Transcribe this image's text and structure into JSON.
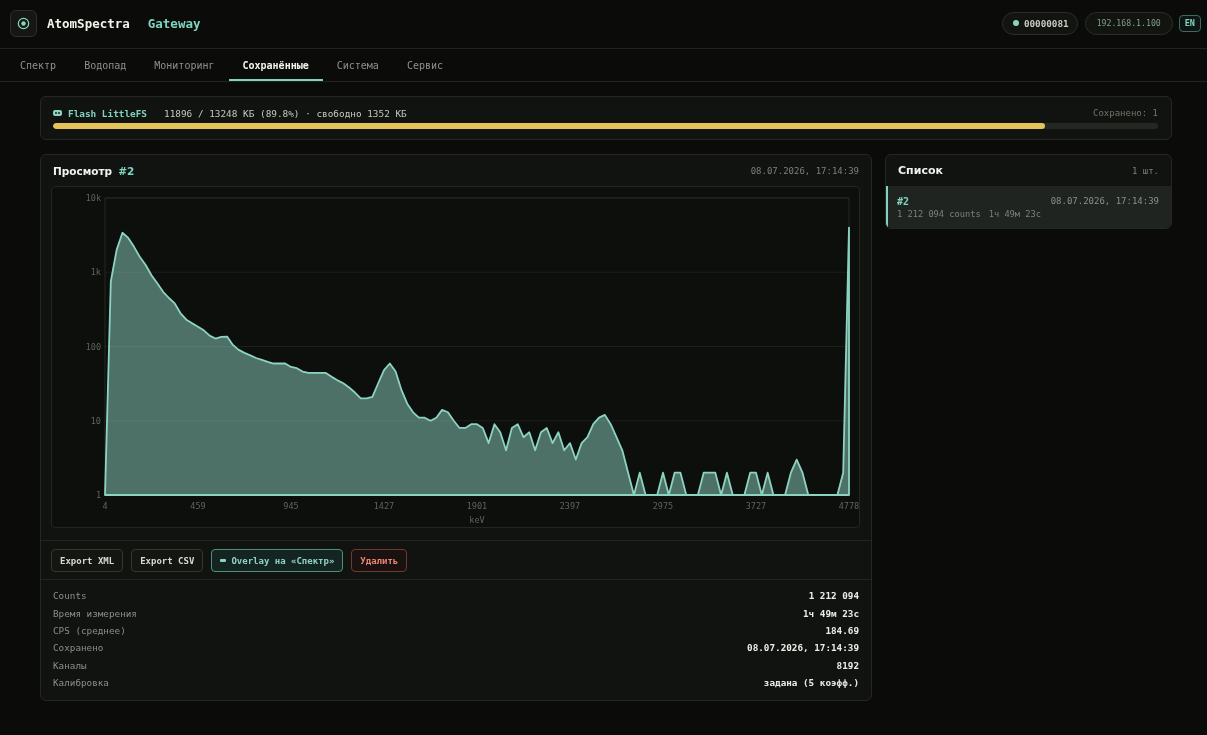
{
  "app": {
    "name": "AtomSpectra",
    "subtitle": "Gateway"
  },
  "status": {
    "device_id": "00000081",
    "ip": "192.168.1.100",
    "language": "EN"
  },
  "tabs": [
    {
      "label": "Спектр",
      "selected": false
    },
    {
      "label": "Водопад",
      "selected": false
    },
    {
      "label": "Мониторинг",
      "selected": false
    },
    {
      "label": "Сохранённые",
      "selected": true
    },
    {
      "label": "Система",
      "selected": false
    },
    {
      "label": "Сервис",
      "selected": false
    }
  ],
  "storage": {
    "name": "Flash LittleFS",
    "usage": "11896 / 13248 КБ (89.8%) · свободно 1352 КБ",
    "saved": "Сохранено: 1",
    "level": 0.898
  },
  "preview": {
    "title": "Просмотр",
    "record_id": "#2",
    "timestamp": "08.07.2026, 17:14:39",
    "chart_data": {
      "type": "area",
      "xlabel": "keV",
      "log": true,
      "grid": true,
      "categories": [
        "4",
        null,
        null,
        null,
        null,
        null,
        null,
        null,
        null,
        null,
        null,
        null,
        null,
        null,
        null,
        null,
        "459",
        null,
        null,
        null,
        null,
        null,
        null,
        null,
        null,
        null,
        null,
        null,
        null,
        null,
        null,
        null,
        "945",
        null,
        null,
        null,
        null,
        null,
        null,
        null,
        null,
        null,
        null,
        null,
        null,
        null,
        null,
        null,
        "1427",
        null,
        null,
        null,
        null,
        null,
        null,
        null,
        null,
        null,
        null,
        null,
        null,
        null,
        null,
        null,
        "1901",
        null,
        null,
        null,
        null,
        null,
        null,
        null,
        null,
        null,
        null,
        null,
        null,
        null,
        null,
        null,
        "2397",
        null,
        null,
        null,
        null,
        null,
        null,
        null,
        null,
        null,
        null,
        null,
        null,
        null,
        null,
        null,
        "2975",
        null,
        null,
        null,
        null,
        null,
        null,
        null,
        null,
        null,
        null,
        null,
        null,
        null,
        null,
        null,
        "3727",
        null,
        null,
        null,
        null,
        null,
        null,
        null,
        null,
        null,
        null,
        null,
        null,
        null,
        null,
        null,
        "4778"
      ],
      "series": [
        {
          "color": "#8dd3c2",
          "values": [
            1,
            750,
            2000,
            3400,
            2900,
            2200,
            1600,
            1250,
            910,
            710,
            545,
            450,
            380,
            280,
            230,
            205,
            185,
            165,
            140,
            128,
            135,
            136,
            105,
            90,
            82,
            76,
            70,
            66,
            62,
            59,
            59,
            59,
            53,
            51,
            46,
            44,
            44,
            44,
            44,
            39,
            35,
            32,
            28,
            24,
            20,
            20,
            21,
            32,
            48,
            59,
            46,
            26,
            17,
            13,
            11,
            11,
            10,
            11,
            14,
            13,
            10,
            8,
            8,
            9,
            9,
            8,
            5,
            9,
            7,
            4,
            8,
            9,
            6,
            7,
            4,
            7,
            8,
            5,
            7,
            4,
            5,
            3,
            5,
            6,
            9,
            11,
            12,
            9,
            6,
            4,
            2,
            1,
            2,
            1,
            1,
            1,
            2,
            1,
            2,
            2,
            1,
            1,
            1,
            2,
            2,
            2,
            1,
            2,
            1,
            1,
            1,
            2,
            2,
            1,
            2,
            1,
            1,
            1,
            2,
            3,
            2,
            1,
            1,
            1,
            1,
            1,
            1,
            2,
            4000
          ]
        }
      ],
      "ylim": [
        1,
        10000
      ],
      "yticks": [
        {
          "value": 1,
          "label": "1"
        },
        {
          "value": 10,
          "label": "10"
        },
        {
          "value": 100,
          "label": "100"
        },
        {
          "value": 1000,
          "label": "1k"
        },
        {
          "value": 10000,
          "label": "10k"
        }
      ]
    },
    "actions": [
      {
        "label": "Export XML",
        "kind": "default"
      },
      {
        "label": "Export CSV",
        "kind": "default"
      },
      {
        "label": "Overlay на «Спектр»",
        "kind": "overlay"
      },
      {
        "label": "Удалить",
        "kind": "danger"
      }
    ],
    "stats": [
      {
        "label": "Counts",
        "value": "1 212 094"
      },
      {
        "label": "Время измерения",
        "value": "1ч 49м 23с"
      },
      {
        "label": "CPS (среднее)",
        "value": "184.69"
      },
      {
        "label": "Сохранено",
        "value": "08.07.2026, 17:14:39"
      },
      {
        "label": "Каналы",
        "value": "8192"
      },
      {
        "label": "Калибровка",
        "value": "задана (5 коэфф.)"
      }
    ]
  },
  "list": {
    "title": "Список",
    "count": "1 шт.",
    "items": [
      {
        "id": "#2",
        "timestamp": "08.07.2026, 17:14:39",
        "counts": "1 212 094 counts",
        "duration": "1ч 49м 23с",
        "selected": true
      }
    ]
  }
}
